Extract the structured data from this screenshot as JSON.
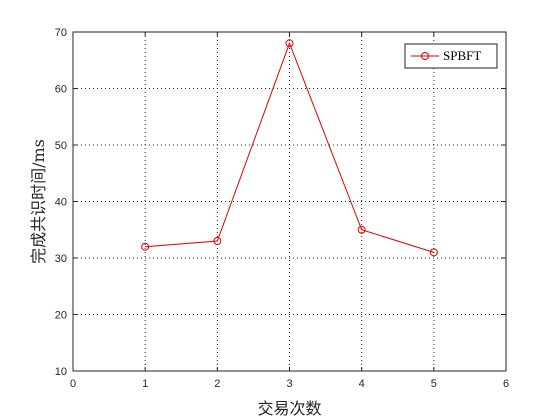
{
  "chart_data": {
    "type": "line",
    "title": "",
    "xlabel": "交易次数",
    "ylabel": "完成共识时间/ms",
    "xlim": [
      0,
      6
    ],
    "ylim": [
      10,
      70
    ],
    "xticks": [
      0,
      1,
      2,
      3,
      4,
      5,
      6
    ],
    "yticks": [
      10,
      20,
      30,
      40,
      50,
      60,
      70
    ],
    "grid": true,
    "grid_style": "dotted",
    "legend_position": "top-right",
    "series": [
      {
        "name": "SPBFT",
        "color": "#e00000",
        "marker": "circle-open",
        "x": [
          1,
          2,
          3,
          4,
          5
        ],
        "y": [
          32,
          33,
          68,
          35,
          31
        ]
      }
    ]
  }
}
